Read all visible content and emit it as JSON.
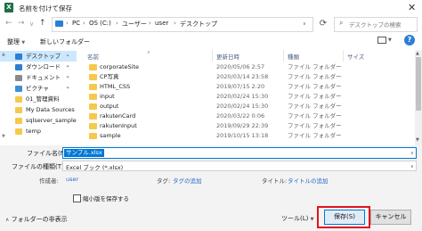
{
  "window": {
    "title": "名前を付けて保存",
    "app_icon": "excel-icon",
    "close_glyph": "✕"
  },
  "nav": {
    "back": "←",
    "forward": "→",
    "recent": "∨",
    "up": "↑",
    "breadcrumbs": [
      "PC",
      "OS (C:)",
      "ユーザー",
      "user",
      "デスクトップ"
    ],
    "separator": "›",
    "refresh": "⟳",
    "search_placeholder": "デスクトップの検索"
  },
  "toolbar": {
    "organize": "整理",
    "new_folder": "新しいフォルダー"
  },
  "sidebar": {
    "items": [
      {
        "label": "デスクトップ",
        "icon": "desktop-icon",
        "color": "#2b7fd4",
        "pinned": true
      },
      {
        "label": "ダウンロード",
        "icon": "download-icon",
        "color": "#2b7fd4",
        "pinned": true
      },
      {
        "label": "ドキュメント",
        "icon": "document-icon",
        "color": "#8a8a8a",
        "pinned": true
      },
      {
        "label": "ピクチャ",
        "icon": "picture-icon",
        "color": "#3d8fd4",
        "pinned": true
      },
      {
        "label": "01_管理資料",
        "icon": "folder-icon",
        "color": "#f5c94c",
        "pinned": false
      },
      {
        "label": "My Data Sources",
        "icon": "folder-icon",
        "color": "#f5c94c",
        "pinned": false
      },
      {
        "label": "sqlserver_sample",
        "icon": "folder-icon",
        "color": "#f5c94c",
        "pinned": false
      },
      {
        "label": "temp",
        "icon": "folder-icon",
        "color": "#f5c94c",
        "pinned": false
      }
    ]
  },
  "files": {
    "columns": {
      "name": "名前",
      "modified": "更新日時",
      "type": "種類",
      "size": "サイズ"
    },
    "rows": [
      {
        "name": "corporateSite",
        "modified": "2020/05/06 2:57",
        "type": "ファイル フォルダー"
      },
      {
        "name": "CP写真",
        "modified": "2020/03/14 23:58",
        "type": "ファイル フォルダー"
      },
      {
        "name": "HTML_CSS",
        "modified": "2019/07/15 2:20",
        "type": "ファイル フォルダー"
      },
      {
        "name": "input",
        "modified": "2020/02/24 15:30",
        "type": "ファイル フォルダー"
      },
      {
        "name": "output",
        "modified": "2020/02/24 15:30",
        "type": "ファイル フォルダー"
      },
      {
        "name": "rakutenCard",
        "modified": "2020/03/22 0:06",
        "type": "ファイル フォルダー"
      },
      {
        "name": "rakutenInput",
        "modified": "2019/09/29 22:39",
        "type": "ファイル フォルダー"
      },
      {
        "name": "sample",
        "modified": "2019/10/15 13:18",
        "type": "ファイル フォルダー"
      }
    ]
  },
  "form": {
    "filename_label": "ファイル名(N):",
    "filename_value": "サンプル.xlsx",
    "filetype_label": "ファイルの種類(T):",
    "filetype_value": "Excel ブック (*.xlsx)",
    "author_label": "作成者:",
    "author_value": "user",
    "tags_label": "タグ:",
    "tags_value": "タグの追加",
    "title_label": "タイトル:",
    "title_value": "タイトルの追加",
    "thumbnail_label": "縮小版を保存する",
    "thumbnail_checked": false
  },
  "footer": {
    "hide_folders": "フォルダーの非表示",
    "hide_glyph": "∧",
    "tools": "ツール(L)",
    "save": "保存(S)",
    "cancel": "キャンセル"
  },
  "colors": {
    "accent": "#0078d7",
    "highlight_frame": "#e0141e",
    "link": "#2a6ac8",
    "folder": "#f5c94c"
  }
}
